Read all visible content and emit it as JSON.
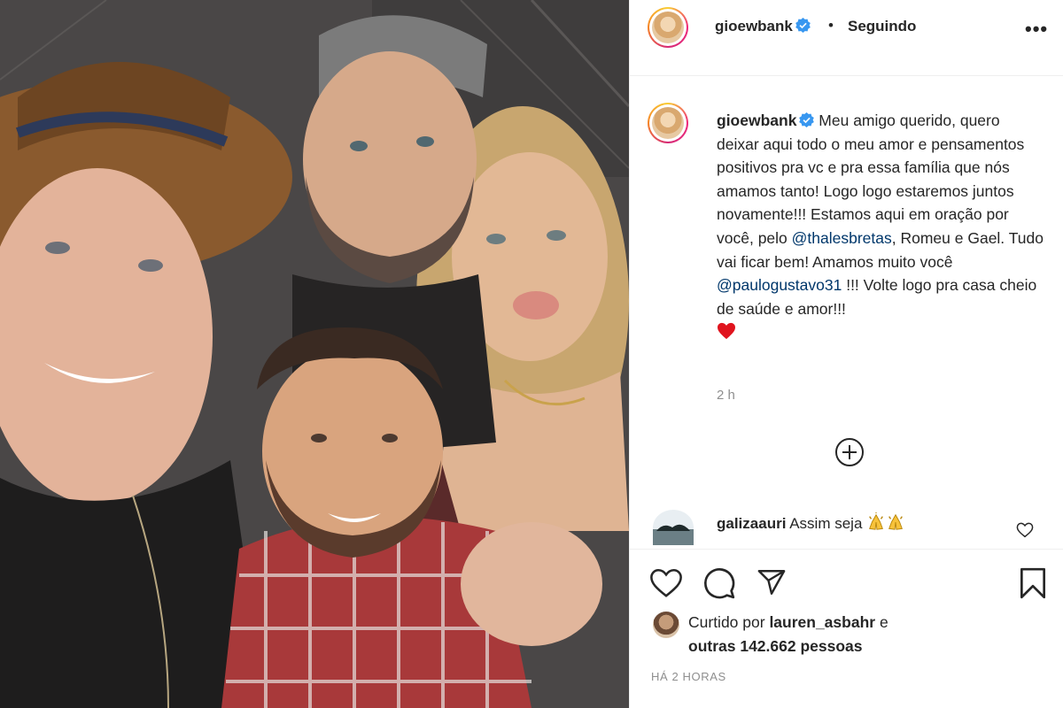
{
  "post": {
    "photo_alt": "",
    "header": {
      "username": "gioewbank",
      "separator": "•",
      "follow_status": "Seguindo",
      "more_icon": "more-options-icon"
    },
    "caption": {
      "username": "gioewbank",
      "text_1": " Meu amigo querido, quero deixar aqui todo o meu amor e pensamentos positivos pra vc e pra essa família que nós amamos tanto! Logo logo estaremos juntos novamente!!! Estamos aqui em oração por você, pelo ",
      "mention_1": "@thalesbretas",
      "text_2": ", Romeu e Gael. Tudo vai ficar bem! Amamos muito você ",
      "mention_2": "@paulogustavo31",
      "text_3": " !!! Volte logo pra casa cheio de saúde e amor!!!",
      "emoji": "red-heart",
      "time": "2 h"
    },
    "comments": [
      {
        "username": "galizaauri",
        "text": " Assim seja ",
        "emojis": [
          "praying-hands",
          "praying-hands"
        ]
      }
    ],
    "actions": {
      "like_icon": "heart-icon",
      "comment_icon": "comment-icon",
      "share_icon": "send-icon",
      "save_icon": "bookmark-icon"
    },
    "likes": {
      "prefix": "Curtido por ",
      "user": "lauren_asbahr",
      "middle": " e",
      "others": "outras 142.662 pessoas"
    },
    "timestamp": "HÁ 2 HORAS"
  },
  "colors": {
    "text": "#262626",
    "secondary": "#8e8e8e",
    "mention": "#00376b",
    "verified": "#3897f0",
    "border": "#efefef"
  }
}
